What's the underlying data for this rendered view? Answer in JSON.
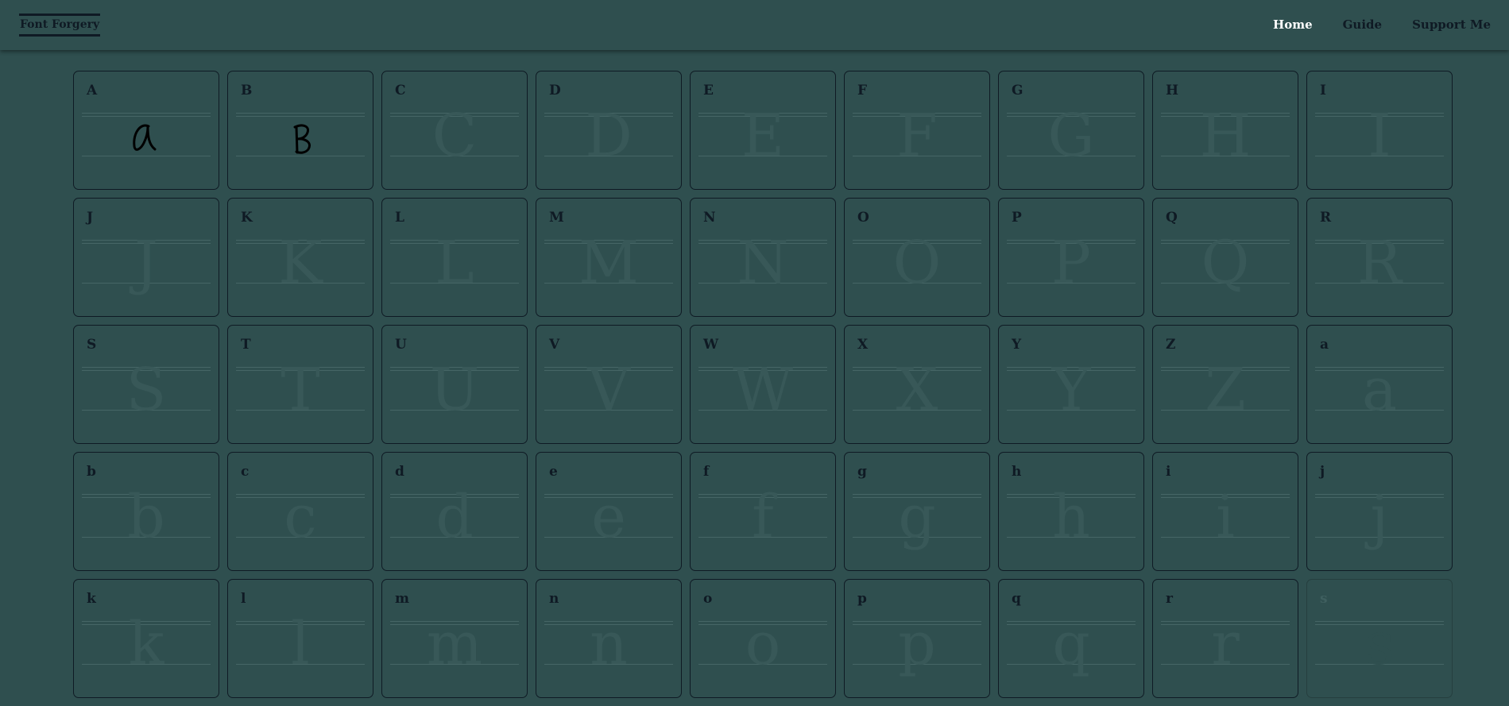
{
  "nav": {
    "brand": "Font Forgery",
    "links": [
      {
        "label": "Home",
        "active": true
      },
      {
        "label": "Guide",
        "active": false
      },
      {
        "label": "Support Me",
        "active": false
      }
    ]
  },
  "grid": {
    "cells": [
      {
        "char": "A",
        "drawn": true,
        "faded": false
      },
      {
        "char": "B",
        "drawn": true,
        "faded": false
      },
      {
        "char": "C",
        "drawn": false,
        "faded": false
      },
      {
        "char": "D",
        "drawn": false,
        "faded": false
      },
      {
        "char": "E",
        "drawn": false,
        "faded": false
      },
      {
        "char": "F",
        "drawn": false,
        "faded": false
      },
      {
        "char": "G",
        "drawn": false,
        "faded": false
      },
      {
        "char": "H",
        "drawn": false,
        "faded": false
      },
      {
        "char": "I",
        "drawn": false,
        "faded": false
      },
      {
        "char": "J",
        "drawn": false,
        "faded": false
      },
      {
        "char": "K",
        "drawn": false,
        "faded": false
      },
      {
        "char": "L",
        "drawn": false,
        "faded": false
      },
      {
        "char": "M",
        "drawn": false,
        "faded": false
      },
      {
        "char": "N",
        "drawn": false,
        "faded": false
      },
      {
        "char": "O",
        "drawn": false,
        "faded": false
      },
      {
        "char": "P",
        "drawn": false,
        "faded": false
      },
      {
        "char": "Q",
        "drawn": false,
        "faded": false
      },
      {
        "char": "R",
        "drawn": false,
        "faded": false
      },
      {
        "char": "S",
        "drawn": false,
        "faded": false
      },
      {
        "char": "T",
        "drawn": false,
        "faded": false
      },
      {
        "char": "U",
        "drawn": false,
        "faded": false
      },
      {
        "char": "V",
        "drawn": false,
        "faded": false
      },
      {
        "char": "W",
        "drawn": false,
        "faded": false
      },
      {
        "char": "X",
        "drawn": false,
        "faded": false
      },
      {
        "char": "Y",
        "drawn": false,
        "faded": false
      },
      {
        "char": "Z",
        "drawn": false,
        "faded": false
      },
      {
        "char": "a",
        "drawn": false,
        "faded": false
      },
      {
        "char": "b",
        "drawn": false,
        "faded": false
      },
      {
        "char": "c",
        "drawn": false,
        "faded": false
      },
      {
        "char": "d",
        "drawn": false,
        "faded": false
      },
      {
        "char": "e",
        "drawn": false,
        "faded": false
      },
      {
        "char": "f",
        "drawn": false,
        "faded": false
      },
      {
        "char": "g",
        "drawn": false,
        "faded": false
      },
      {
        "char": "h",
        "drawn": false,
        "faded": false
      },
      {
        "char": "i",
        "drawn": false,
        "faded": false
      },
      {
        "char": "j",
        "drawn": false,
        "faded": false
      },
      {
        "char": "k",
        "drawn": false,
        "faded": false
      },
      {
        "char": "l",
        "drawn": false,
        "faded": false
      },
      {
        "char": "m",
        "drawn": false,
        "faded": false
      },
      {
        "char": "n",
        "drawn": false,
        "faded": false
      },
      {
        "char": "o",
        "drawn": false,
        "faded": false
      },
      {
        "char": "p",
        "drawn": false,
        "faded": false
      },
      {
        "char": "q",
        "drawn": false,
        "faded": false
      },
      {
        "char": "r",
        "drawn": false,
        "faded": false
      },
      {
        "char": "s",
        "drawn": false,
        "faded": true
      }
    ]
  },
  "colors": {
    "background": "#2f4f4f",
    "text": "#0f1a24",
    "active_link": "#ffffff",
    "guide_line": "#466666",
    "ghost_glyph": "#385858"
  }
}
